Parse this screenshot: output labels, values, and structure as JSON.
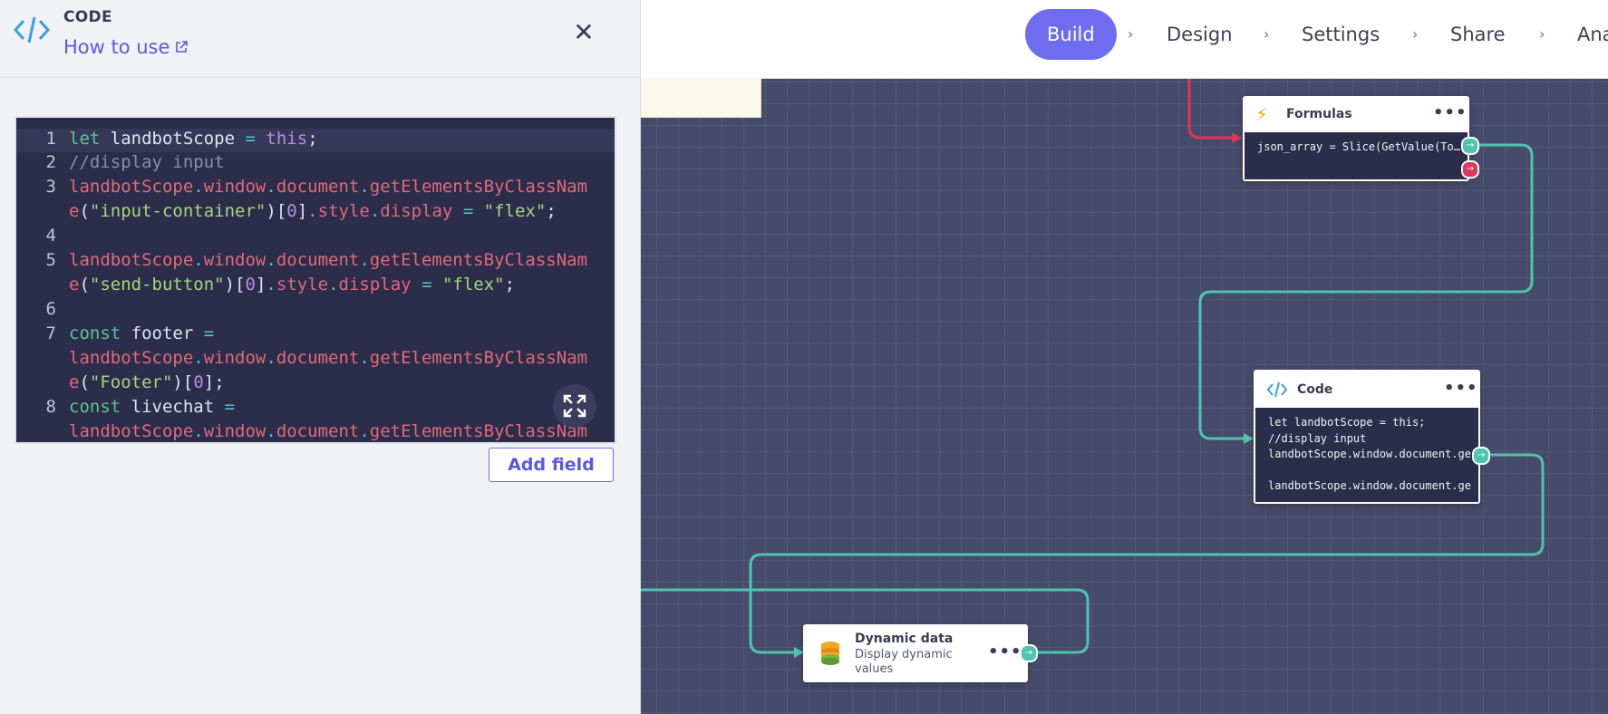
{
  "nav": {
    "items": [
      {
        "label": "Build",
        "active": true
      },
      {
        "label": "Design"
      },
      {
        "label": "Settings"
      },
      {
        "label": "Share"
      },
      {
        "label": "Ana"
      }
    ],
    "separator": "›",
    "accent_color": "#6e6df0"
  },
  "panel": {
    "title": "CODE",
    "how_to_use": "How to use",
    "logo_icon": "code-icon",
    "close_icon": "close-icon",
    "close_glyph": "✕",
    "add_field_label": "Add field"
  },
  "editor": {
    "lines": [
      {
        "num": "1",
        "text": "let landbotScope = this;"
      },
      {
        "num": "2",
        "text": "//display input"
      },
      {
        "num": "3",
        "text": "landbotScope.window.document.getElementsByClassNam"
      },
      {
        "num": "",
        "text": "e(\"input-container\")[0].style.display = \"flex\";"
      },
      {
        "num": "4",
        "text": ""
      },
      {
        "num": "5",
        "text": "landbotScope.window.document.getElementsByClassNam"
      },
      {
        "num": "",
        "text": "e(\"send-button\")[0].style.display = \"flex\";"
      },
      {
        "num": "6",
        "text": ""
      },
      {
        "num": "7",
        "text": "const footer ="
      },
      {
        "num": "",
        "text": "landbotScope.window.document.getElementsByClassNam"
      },
      {
        "num": "",
        "text": "e(\"Footer\")[0];"
      },
      {
        "num": "8",
        "text": "const livechat ="
      },
      {
        "num": "",
        "text": "landbotScope.window.document.getElementsByClassNam"
      }
    ],
    "expand_icon": "expand-icon"
  },
  "blocks": {
    "formulas": {
      "title": "Formulas",
      "icon": "lightning-icon",
      "body": "json_array = Slice(GetValue(To…"
    },
    "code": {
      "title": "Code",
      "icon": "code-icon",
      "body": "let landbotScope = this;\n//display input\nlandbotScope.window.document.ge\n\nlandbotScope.window.document.ge"
    },
    "dynamic": {
      "title": "Dynamic data",
      "subtitle_1": "Display dynamic",
      "subtitle_2": "values",
      "icon": "database-icon"
    },
    "menu_glyph": "•••",
    "port_glyph": "→"
  },
  "colors": {
    "canvas": "#474b6b",
    "connector_green": "#4fc4b0",
    "connector_red": "#e0355b",
    "code_bg": "#2c2d4a"
  }
}
